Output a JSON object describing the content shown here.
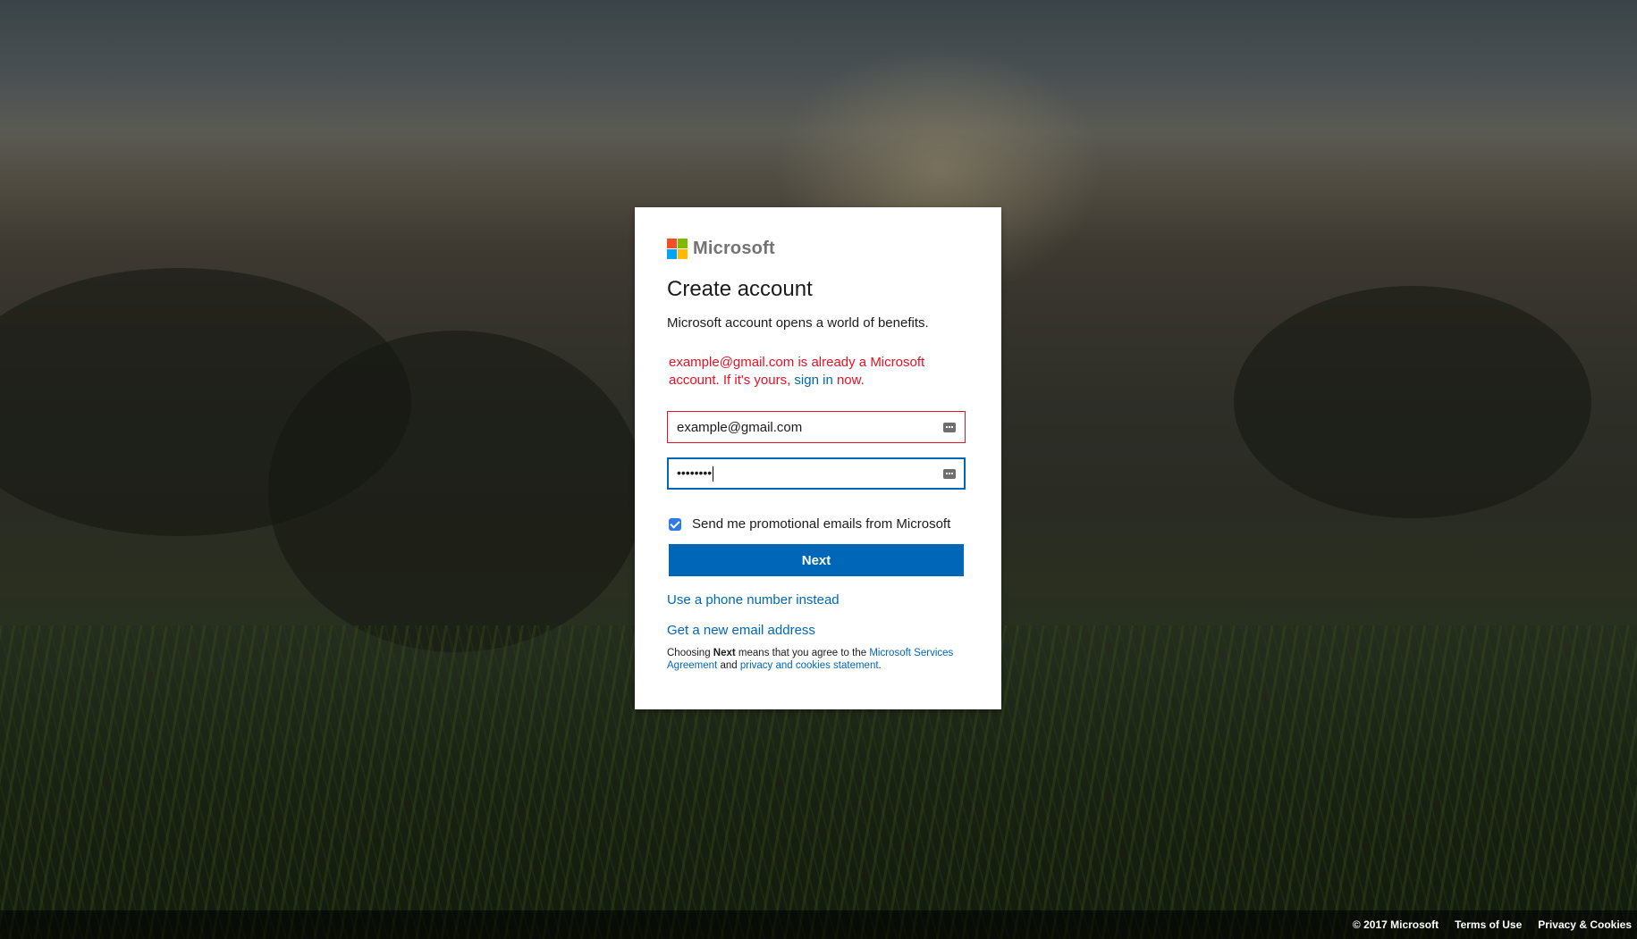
{
  "brand": {
    "name": "Microsoft",
    "logo_colors": [
      "#f25022",
      "#7fba00",
      "#00a4ef",
      "#ffb900"
    ]
  },
  "card": {
    "title": "Create account",
    "subtitle": "Microsoft account opens a world of benefits.",
    "error": {
      "line1": "example@gmail.com is already a Microsoft",
      "line2_prefix": "account. If it's yours, ",
      "sign_in_link": "sign in",
      "line2_suffix": " now."
    },
    "email_field": {
      "value": "example@gmail.com"
    },
    "password_field": {
      "masked_value": "••••••••"
    },
    "promo_checkbox": {
      "checked": true,
      "label": "Send me promotional emails from Microsoft"
    },
    "next_button": "Next",
    "phone_link": "Use a phone number instead",
    "new_email_link": "Get a new email address",
    "legal": {
      "prefix": "Choosing ",
      "bold": "Next",
      "middle": " means that you agree to the ",
      "agreement_link": "Microsoft Services Agreement",
      "and": " and ",
      "privacy_link": "privacy and cookies statement",
      "suffix": "."
    }
  },
  "footer": {
    "copyright": "© 2017 Microsoft",
    "terms": "Terms of Use",
    "privacy": "Privacy & Cookies"
  },
  "colors": {
    "accent": "#0067b8",
    "error": "#e81123"
  }
}
